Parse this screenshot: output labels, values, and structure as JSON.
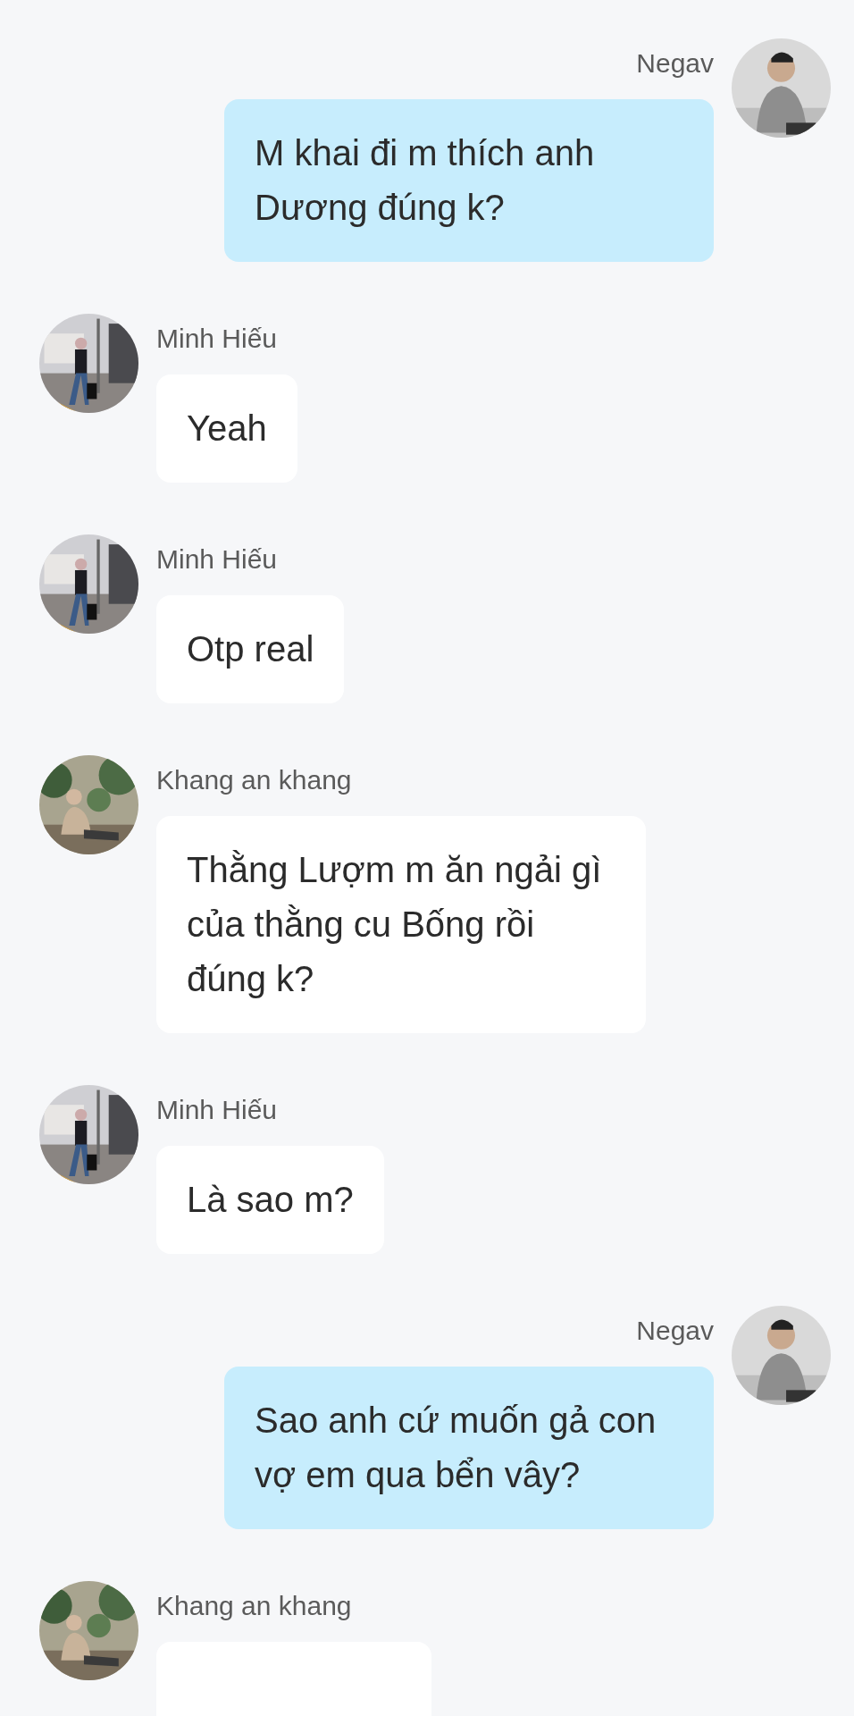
{
  "messages": [
    {
      "kind": "sent",
      "sender": "Negav",
      "avatar": {
        "kind": "grey"
      },
      "text": "M khai đi m thích anh Dương đúng k?"
    },
    {
      "kind": "received",
      "sender": "Minh Hiếu",
      "avatar": {
        "kind": "street"
      },
      "text": "Yeah"
    },
    {
      "kind": "received",
      "sender": "Minh Hiếu",
      "avatar": {
        "kind": "street"
      },
      "text": "Otp real"
    },
    {
      "kind": "received",
      "sender": "Khang an khang",
      "avatar": {
        "kind": "plants"
      },
      "text": "Thằng Lượm m ăn ngải gì của thằng cu Bống rồi đúng k?"
    },
    {
      "kind": "received",
      "sender": "Minh Hiếu",
      "avatar": {
        "kind": "street"
      },
      "text": "Là sao m?"
    },
    {
      "kind": "sent",
      "sender": "Negav",
      "avatar": {
        "kind": "grey"
      },
      "text": "Sao anh cứ muốn gả con vợ em qua bển vây?"
    },
    {
      "kind": "received",
      "sender": "Khang an khang",
      "avatar": {
        "kind": "plants"
      }
    }
  ]
}
